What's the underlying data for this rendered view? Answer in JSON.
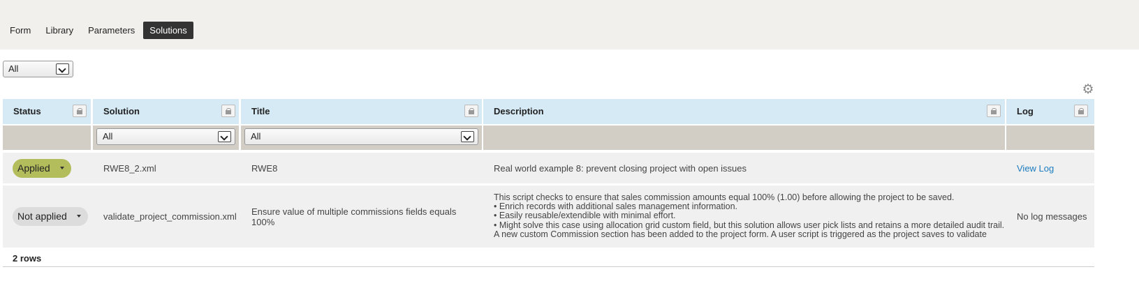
{
  "tabs": [
    {
      "label": "Form",
      "active": false
    },
    {
      "label": "Library",
      "active": false
    },
    {
      "label": "Parameters",
      "active": false
    },
    {
      "label": "Solutions",
      "active": true
    }
  ],
  "status_filter": {
    "value": "All"
  },
  "gear_icon": "gear-icon",
  "table": {
    "columns": [
      "Status",
      "Solution",
      "Title",
      "Description",
      "Log"
    ],
    "filters": {
      "solution": "All",
      "title": "All"
    },
    "rows": [
      {
        "status": "Applied",
        "solution": "RWE8_2.xml",
        "title": "RWE8",
        "description": [
          "Real world example 8: prevent closing project with open issues"
        ],
        "log": "View Log"
      },
      {
        "status": "Not applied",
        "solution": "validate_project_commission.xml",
        "title": "Ensure value of multiple commissions fields equals 100%",
        "description": [
          "This script checks to ensure that sales commission amounts equal 100% (1.00) before allowing the project to be saved.",
          "• Enrich records with additional sales management information.",
          "• Easily reusable/extendible with minimal effort.",
          "• Might solve this case using allocation grid custom field, but this solution allows user pick lists and retains a more detailed audit trail.",
          "A new custom Commission section has been added to the project form. A user script is triggered as the project saves to validate"
        ],
        "log": "No log messages"
      }
    ]
  },
  "footer": {
    "rows_count": "2 rows"
  },
  "colors": {
    "applied": "#b3bd5c",
    "header_bg": "#d6eaf5",
    "filter_bg": "#d2cec6",
    "link": "#1a7bbf"
  }
}
